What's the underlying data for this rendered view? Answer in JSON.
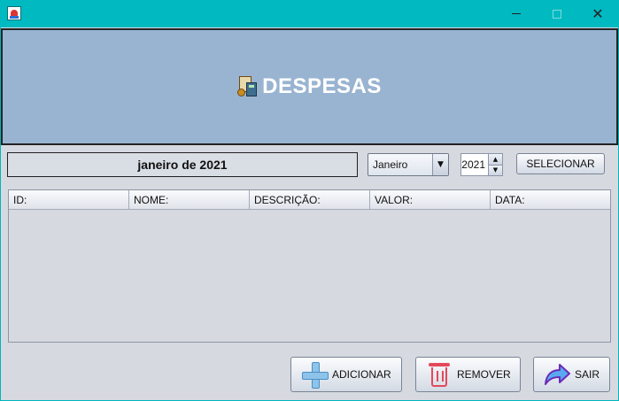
{
  "window": {
    "minimize_icon": "minimize-icon",
    "maximize_icon": "maximize-icon",
    "close_glyph": "✕"
  },
  "banner": {
    "icon": "expenses-icon",
    "title": "DESPESAS",
    "background": "#99b4d1"
  },
  "filter": {
    "period_label": "janeiro de 2021",
    "month_value": "Janeiro",
    "year_value": "2021",
    "select_label": "SELECIONAR"
  },
  "table": {
    "columns": [
      "ID:",
      "NOME:",
      "DESCRIÇÃO:",
      "VALOR:",
      "DATA:"
    ],
    "rows": []
  },
  "actions": {
    "add_label": "ADICIONAR",
    "remove_label": "REMOVER",
    "exit_label": "SAIR"
  },
  "colors": {
    "titlebar": "#00b9c1",
    "accent_add": "#8ec3ea",
    "accent_remove": "#e5485b",
    "accent_exit": "#2a5bd7"
  }
}
